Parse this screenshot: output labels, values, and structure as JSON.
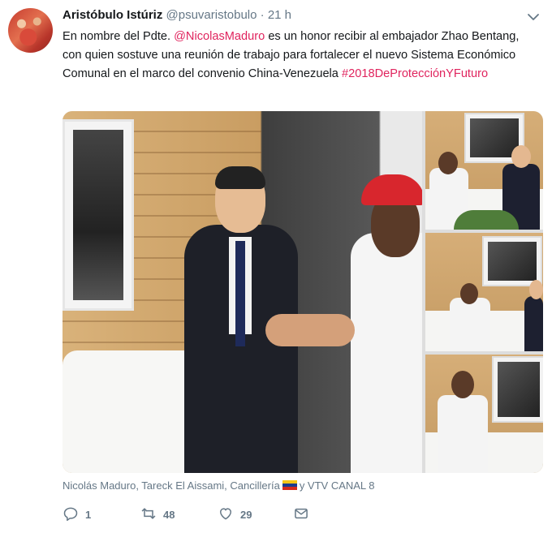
{
  "tweet": {
    "author_name": "Aristóbulo Istúriz",
    "handle": "@psuvaristobulo",
    "separator": "·",
    "time": "21 h",
    "text_parts": {
      "p1": "En nombre del Pdte. ",
      "mention": "@NicolasMaduro",
      "p2": " es un honor recibir al embajador Zhao Bentang, con quien sostuve una reunión de trabajo para fortalecer el nuevo Sistema Económico Comunal en el marco del convenio China-Venezuela ",
      "hashtag": "#2018DeProtecciónYFuturo"
    },
    "credits_before_flag": "Nicolás Maduro, Tareck El Aissami, Cancillería",
    "credits_after_flag": "y VTV CANAL 8",
    "actions": {
      "reply_count": "1",
      "retweet_count": "48",
      "like_count": "29"
    }
  },
  "colors": {
    "link": "#e0245e",
    "muted": "#657786",
    "text": "#14171a"
  },
  "icons": [
    "chevron-down-icon",
    "reply-icon",
    "retweet-icon",
    "like-icon",
    "message-icon",
    "venezuela-flag-icon"
  ]
}
